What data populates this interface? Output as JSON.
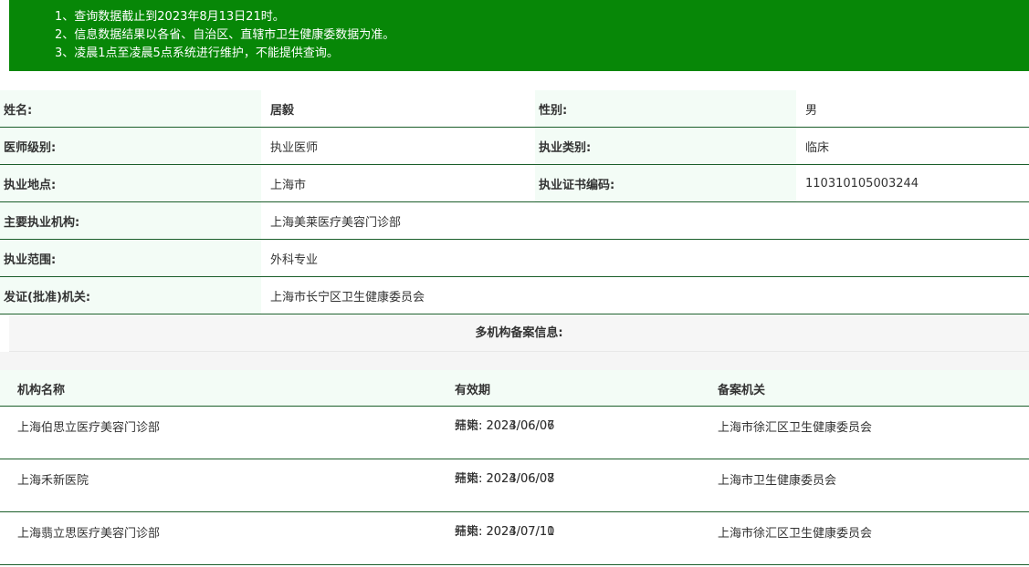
{
  "notice": {
    "lines": [
      "1、查询数据截止到2023年8月13日21时。",
      "2、信息数据结果以各省、自治区、直辖市卫生健康委数据为准。",
      "3、凌晨1点至凌晨5点系统进行维护，不能提供查询。"
    ]
  },
  "doctor": {
    "name_label": "姓名:",
    "name": "居毅",
    "gender_label": "性别:",
    "gender": "男",
    "level_label": "医师级别:",
    "level": "执业医师",
    "category_label": "执业类别:",
    "category": "临床",
    "location_label": "执业地点:",
    "location": "上海市",
    "cert_label": "执业证书编码:",
    "cert": "110310105003244",
    "institution_label": "主要执业机构:",
    "institution": "上海美莱医疗美容门诊部",
    "scope_label": "执业范围:",
    "scope": "外科专业",
    "issuer_label": "发证(批准)机关:",
    "issuer": "上海市长宁区卫生健康委员会"
  },
  "multi": {
    "title": "多机构备案信息:",
    "headers": {
      "name": "机构名称",
      "valid": "有效期",
      "authority": "备案机关"
    },
    "records": [
      {
        "name": "上海伯思立医疗美容门诊部",
        "start": "开始:  2023/06/07",
        "end": "结束:  2024/06/06",
        "authority": "上海市徐汇区卫生健康委员会"
      },
      {
        "name": "上海禾新医院",
        "start": "开始:  2023/06/08",
        "end": "结束:  2024/06/07",
        "authority": "上海市卫生健康委员会"
      },
      {
        "name": "上海翡立思医疗美容门诊部",
        "start": "开始:  2023/07/11",
        "end": "结束:  2024/07/10",
        "authority": "上海市徐汇区卫生健康委员会"
      }
    ]
  }
}
